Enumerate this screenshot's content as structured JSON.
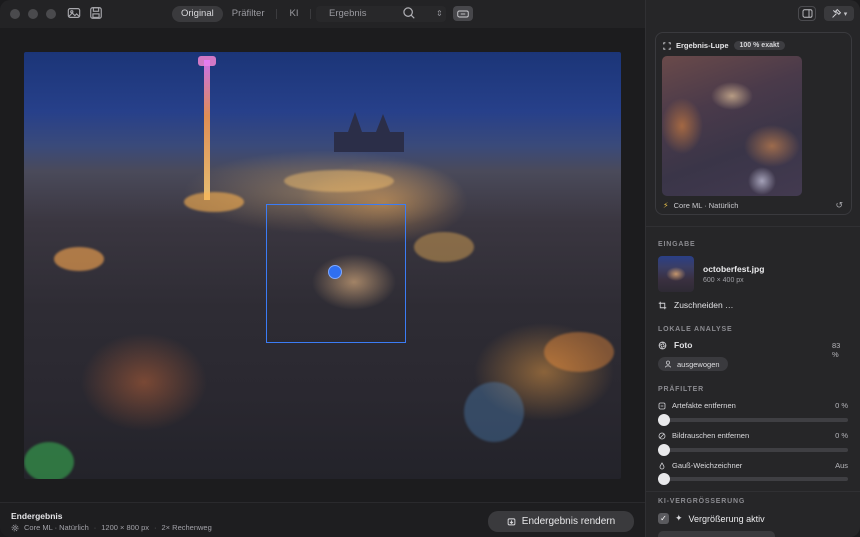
{
  "toolbar": {
    "tabs": [
      {
        "label": "Original",
        "active": true
      },
      {
        "label": "Präfilter",
        "active": false
      },
      {
        "label": "KI",
        "active": false
      }
    ],
    "compare_label": "Ergebnis"
  },
  "canvas": {
    "image_icons": [
      "photo-icon",
      "save-icon"
    ]
  },
  "status": {
    "title": "Endergebnis",
    "engine": "Core ML · Natürlich",
    "size": "1200 × 800 px",
    "passes": "2× Rechenweg",
    "render_label": "Endergebnis rendern"
  },
  "lupe": {
    "title": "Ergebnis-Lupe",
    "badge": "100 % exakt",
    "footer": "Core ML · Natürlich"
  },
  "input": {
    "section": "EINGABE",
    "filename": "octoberfest.jpg",
    "dimensions": "600 × 400 px",
    "crop_label": "Zuschneiden …"
  },
  "analysis": {
    "section": "LOKALE ANALYSE",
    "label": "Foto",
    "value": "83 %",
    "chip": "ausgewogen"
  },
  "prefilter": {
    "section": "PRÄFILTER",
    "sliders": [
      {
        "label": "Artefakte entfernen",
        "value": "0 %",
        "level": 0
      },
      {
        "label": "Bildrauschen entfernen",
        "value": "0 %",
        "level": 0
      },
      {
        "label": "Gauß-Weichzeichner",
        "value": "Aus",
        "level": 0
      }
    ]
  },
  "upscale": {
    "section": "KI-VERGRÖSSERUNG",
    "check_label": "Vergrößerung aktiv",
    "checked": true
  },
  "colors": {
    "accent": "#3b7cf5",
    "background": "#1e1e20",
    "sidebar": "#262628"
  }
}
